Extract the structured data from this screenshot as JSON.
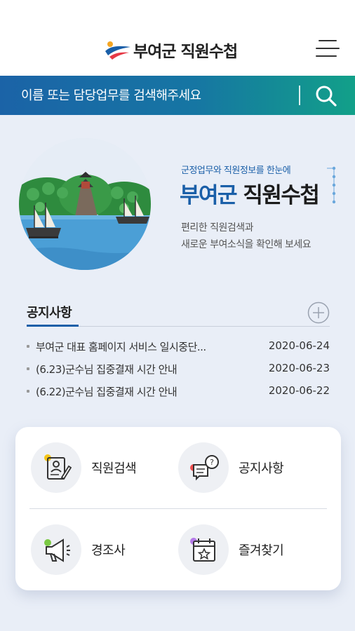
{
  "header": {
    "logo_main": "부여군",
    "logo_sub": "직원수첩"
  },
  "search": {
    "placeholder": "이름 또는 담당업무를 검색해주세요"
  },
  "hero": {
    "subtitle": "군정업무와 직원정보를 한눈에",
    "title_accent": "부여군",
    "title_rest": "직원수첩",
    "desc_line1": "편리한 직원검색과",
    "desc_line2": "새로운 부여소식을 확인해 보세요"
  },
  "notice": {
    "title": "공지사항",
    "items": [
      {
        "text": "부여군 대표 홈페이지 서비스 일시중단...",
        "date": "2020-06-24"
      },
      {
        "text": "(6.23)군수님 집중결재 시간 안내",
        "date": "2020-06-23"
      },
      {
        "text": "(6.22)군수님 집중결재 시간 안내",
        "date": "2020-06-22"
      }
    ]
  },
  "quick_menu": [
    {
      "label": "직원검색",
      "icon": "employee-search-icon",
      "dot_color": "#f5c518"
    },
    {
      "label": "공지사항",
      "icon": "notice-chat-icon",
      "dot_color": "#f04e4e"
    },
    {
      "label": "경조사",
      "icon": "megaphone-icon",
      "dot_color": "#7ac943"
    },
    {
      "label": "즐겨찾기",
      "icon": "calendar-star-icon",
      "dot_color": "#b57be8"
    }
  ],
  "colors": {
    "brand_blue": "#1a5fa8",
    "search_gradient_start": "#1b63a7",
    "search_gradient_end": "#12a089",
    "background": "#e9eef7"
  }
}
